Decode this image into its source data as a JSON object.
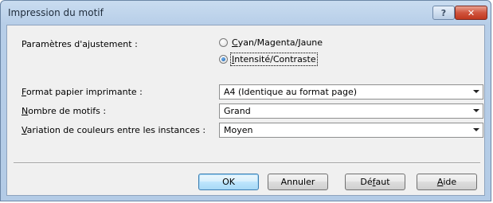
{
  "window": {
    "title": "Impression du motif",
    "help_glyph": "?",
    "close_glyph": "✕"
  },
  "adjustment": {
    "label": "Paramètres d'ajustement :",
    "options": [
      {
        "mnemonic": "C",
        "rest": "yan/Magenta/Jaune",
        "checked": false
      },
      {
        "mnemonic": "I",
        "rest": "ntensité/Contraste",
        "checked": true
      }
    ]
  },
  "paper_format": {
    "label_mnemonic": "F",
    "label_rest": "ormat papier imprimante :",
    "value": "A4 (Identique au format page)"
  },
  "pattern_count": {
    "label_mnemonic": "N",
    "label_rest": "ombre de motifs :",
    "value": "Grand"
  },
  "color_variation": {
    "label_mnemonic": "V",
    "label_rest": "ariation de couleurs entre les instances :",
    "value": "Moyen"
  },
  "buttons": {
    "ok": "OK",
    "cancel": "Annuler",
    "default_pre": "Dé",
    "default_mnemonic": "f",
    "default_post": "aut",
    "help_mnemonic": "A",
    "help_rest": "ide"
  },
  "colors": {
    "title_gradient_top": "#c9dcf0",
    "close_red": "#c0381f",
    "client_bg": "#f0f0f0"
  }
}
